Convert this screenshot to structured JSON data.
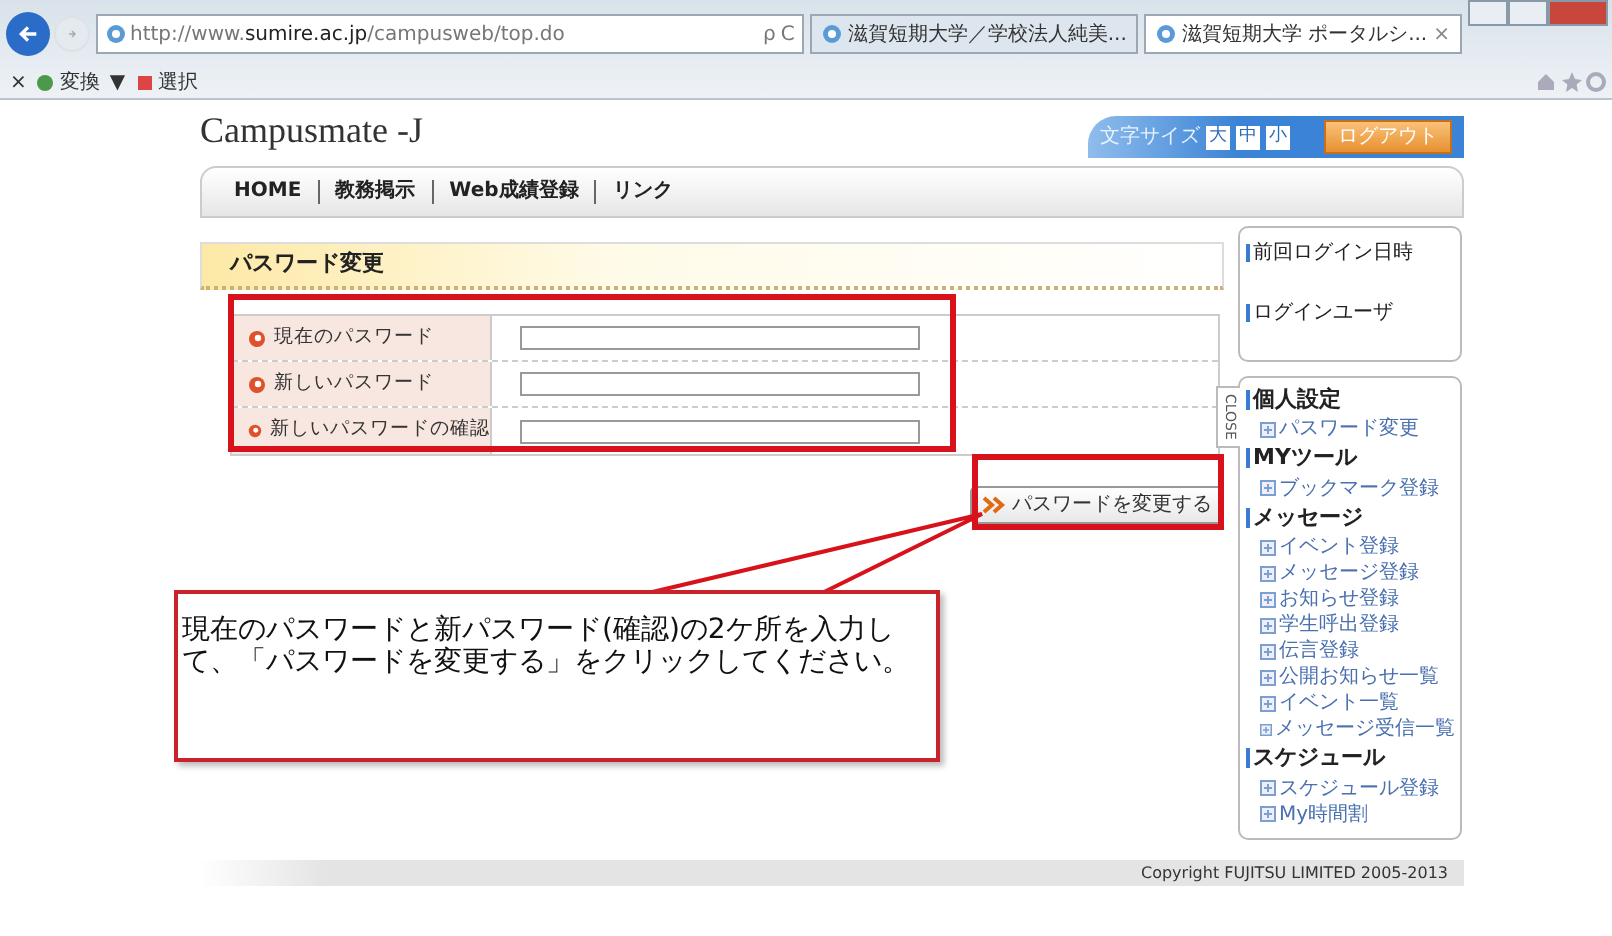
{
  "browser": {
    "address": "http://www.**sumire.ac.jp**/campusweb/top.do",
    "search_glyph": "ρ",
    "refresh_glyph": "C",
    "tabs": [
      {
        "label": "滋賀短期大学／学校法人純美...",
        "selected": false
      },
      {
        "label": "滋賀短期大学 ポータルシ...",
        "selected": true
      }
    ],
    "tab_close": "×",
    "toolbar": {
      "close": "×",
      "items": [
        {
          "label": "変換",
          "caret": "▼"
        },
        {
          "label": "選択"
        }
      ]
    }
  },
  "header": {
    "logo": "Campusmate -J",
    "font_size_label": "文字サイズ",
    "font_sizes": [
      "大",
      "中",
      "小"
    ],
    "logout": "ログアウト"
  },
  "nav": [
    "HOME",
    "教務掲示",
    "Web成績登録",
    "リンク"
  ],
  "page_title": "パスワード変更",
  "form": {
    "fields": [
      {
        "label": "現在のパスワード"
      },
      {
        "label": "新しいパスワード"
      },
      {
        "label": "新しいパスワードの確認"
      }
    ],
    "submit": "パスワードを変更する"
  },
  "callout": "現在のパスワードと新パスワード(確認)の2ケ所を入力して、「パスワードを変更する」をクリックしてください。",
  "sidebar": {
    "login": [
      "前回ログイン日時",
      "ログインユーザ"
    ],
    "close_tab": "CLOSE",
    "menu": [
      {
        "label": "個人設定",
        "children": [
          {
            "label": "パスワード変更"
          }
        ]
      },
      {
        "label": "MYツール",
        "children": [
          {
            "label": "ブックマーク登録"
          }
        ]
      },
      {
        "label": "メッセージ",
        "children": [
          {
            "label": "イベント登録"
          },
          {
            "label": "メッセージ登録"
          },
          {
            "label": "お知らせ登録"
          },
          {
            "label": "学生呼出登録"
          },
          {
            "label": "伝言登録"
          },
          {
            "label": "公開お知らせ一覧"
          },
          {
            "label": "イベント一覧"
          },
          {
            "label": "メッセージ受信一覧"
          }
        ]
      },
      {
        "label": "スケジュール",
        "children": [
          {
            "label": "スケジュール登録"
          },
          {
            "label": "My時間割"
          }
        ]
      }
    ]
  },
  "footer": "Copyright FUJITSU LIMITED 2005-2013"
}
